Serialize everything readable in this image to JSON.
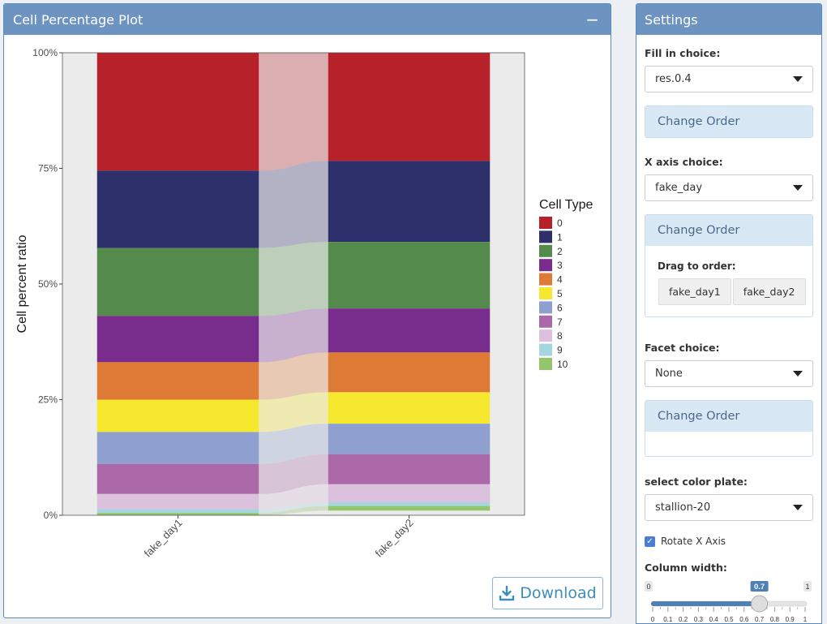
{
  "plot_panel": {
    "title": "Cell Percentage Plot",
    "collapse_label": "−",
    "download_label": "Download"
  },
  "settings": {
    "title": "Settings",
    "fill_label": "Fill in choice:",
    "fill_value": "res.0.4",
    "change_order_label": "Change Order",
    "xaxis_label": "X axis choice:",
    "xaxis_value": "fake_day",
    "drag_label": "Drag to order:",
    "drag_items": [
      "fake_day1",
      "fake_day2"
    ],
    "facet_label": "Facet choice:",
    "facet_value": "None",
    "color_label": "select color plate:",
    "color_value": "stallion-20",
    "rotate_label": "Rotate X Axis",
    "rotate_checked": true,
    "colwidth_label": "Column width:",
    "colwidth": {
      "min": 0,
      "max": 1,
      "value": 0.7,
      "min_label": "0",
      "max_label": "1",
      "value_label": "0.7",
      "ticks": [
        "0",
        "0.1",
        "0.2",
        "0.3",
        "0.4",
        "0.5",
        "0.6",
        "0.7",
        "0.8",
        "0.9",
        "1"
      ]
    }
  },
  "chart_data": {
    "type": "bar",
    "stacked": "percent",
    "xlabel": "",
    "ylabel": "Cell percent ratio",
    "ylim": [
      0,
      1
    ],
    "yticks": [
      0,
      0.25,
      0.5,
      0.75,
      1
    ],
    "ytick_labels": [
      "0%",
      "25%",
      "50%",
      "75%",
      "100%"
    ],
    "categories": [
      "fake_day1",
      "fake_day2"
    ],
    "x_labels_rotated": true,
    "column_width": 0.7,
    "flow_connectors": true,
    "legend_title": "Cell Type",
    "legend_position": "right",
    "series": [
      {
        "name": "0",
        "color": "#B7212A",
        "values": [
          0.255,
          0.234
        ]
      },
      {
        "name": "1",
        "color": "#2E306B",
        "values": [
          0.167,
          0.175
        ]
      },
      {
        "name": "2",
        "color": "#548B4C",
        "values": [
          0.147,
          0.144
        ]
      },
      {
        "name": "3",
        "color": "#782C8B",
        "values": [
          0.1,
          0.095
        ]
      },
      {
        "name": "4",
        "color": "#DE7A35",
        "values": [
          0.081,
          0.086
        ]
      },
      {
        "name": "5",
        "color": "#F6E72F",
        "values": [
          0.07,
          0.068
        ]
      },
      {
        "name": "6",
        "color": "#8F9FD0",
        "values": [
          0.069,
          0.066
        ]
      },
      {
        "name": "7",
        "color": "#AB69A9",
        "values": [
          0.065,
          0.065
        ]
      },
      {
        "name": "8",
        "color": "#DBC1DD",
        "values": [
          0.033,
          0.039
        ]
      },
      {
        "name": "9",
        "color": "#A4D6E0",
        "values": [
          0.008,
          0.008
        ]
      },
      {
        "name": "10",
        "color": "#93C56A",
        "values": [
          0.005,
          0.01
        ]
      }
    ]
  }
}
